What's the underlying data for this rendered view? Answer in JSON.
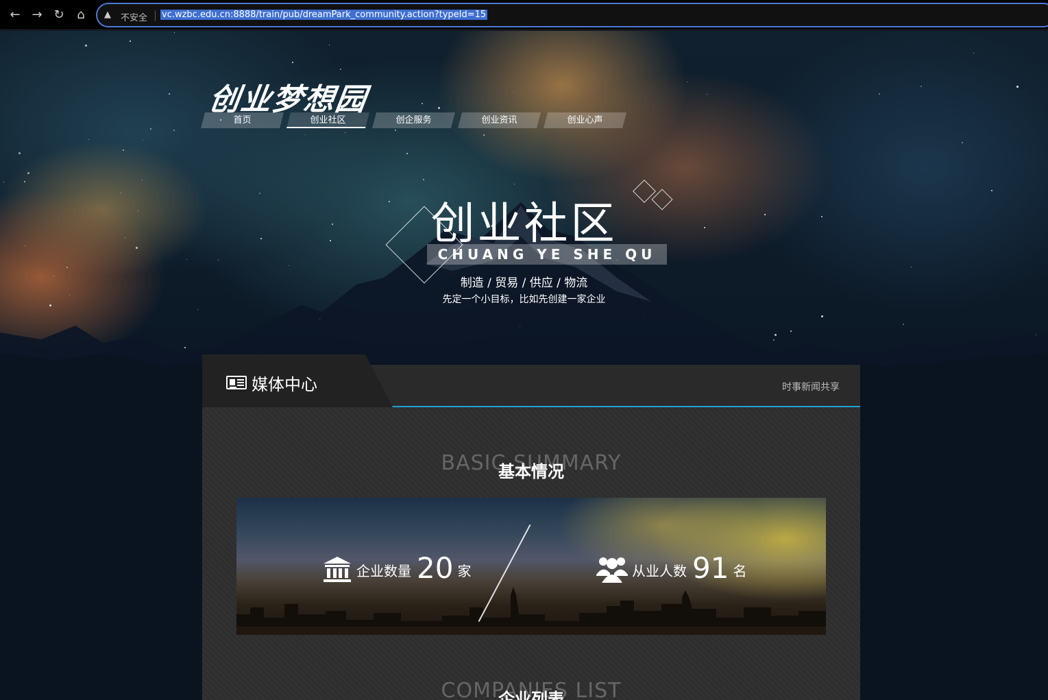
{
  "browser": {
    "security_label": "不安全",
    "url": "vc.wzbc.edu.cn:8888/train/pub/dreamPark_community.action?typeId=15"
  },
  "site": {
    "logo": "创业梦想园",
    "nav": [
      "首页",
      "创业社区",
      "创企服务",
      "创业资讯",
      "创业心声"
    ],
    "active_nav": "创业社区"
  },
  "hero": {
    "title": "创业社区",
    "pinyin": "CHUANG YE SHE QU",
    "subtitle": "制造 / 贸易 / 供应 / 物流",
    "tagline": "先定一个小目标，比如先创建一家企业"
  },
  "panel": {
    "title": "媒体中心",
    "right_text": "时事新闻共享",
    "section1": {
      "bg": "BASIC SUMMARY",
      "fg": "基本情况"
    },
    "stats": [
      {
        "label": "企业数量",
        "value": "20",
        "unit": "家",
        "icon": "bank-icon"
      },
      {
        "label": "从业人数",
        "value": "91",
        "unit": "名",
        "icon": "users-icon"
      }
    ],
    "section2": {
      "bg": "COMPANIES LIST",
      "fg": "企业列表"
    }
  }
}
